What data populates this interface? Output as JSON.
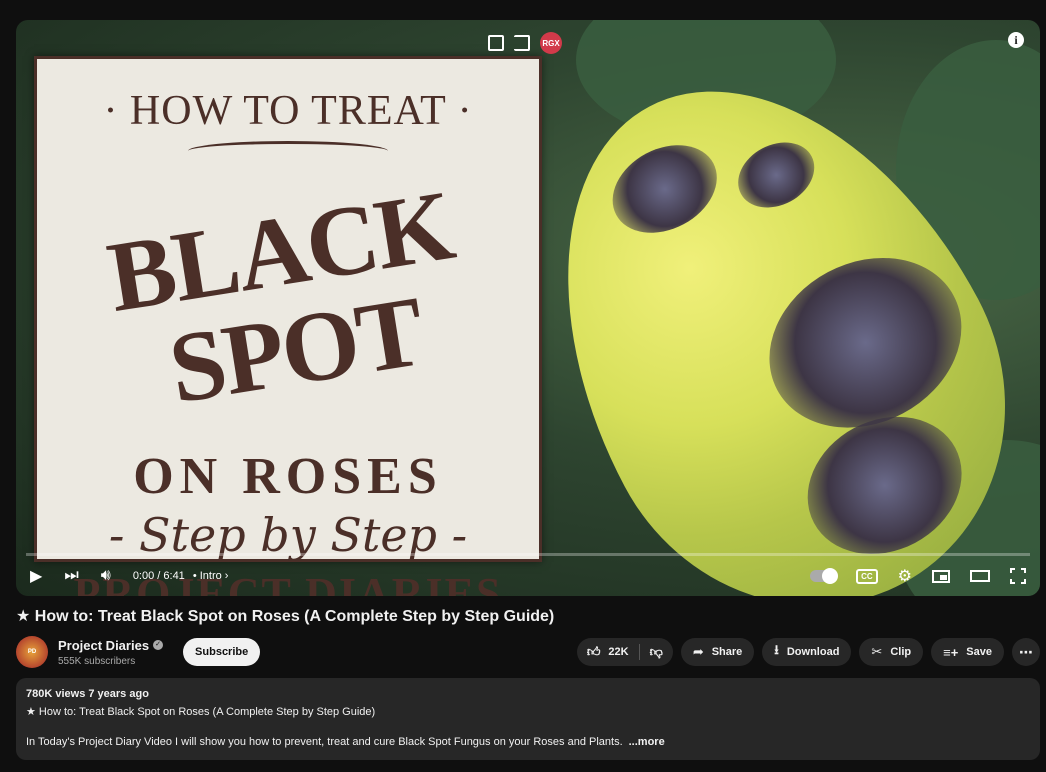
{
  "player": {
    "thumbnail": {
      "line1": "· HOW TO TREAT ·",
      "line2": "BLACK SPOT",
      "line3": "ON ROSES",
      "line4": "- Step by Step -",
      "line5": "PROJECT DIARIES"
    },
    "overlay_badge": "RGX",
    "time": "0:00 / 6:41",
    "chapter": "• Intro",
    "progress_fraction": 0.0
  },
  "video": {
    "title": "★ How to: Treat Black Spot on Roses (A Complete Step by Step Guide)"
  },
  "channel": {
    "name": "Project Diaries",
    "subscribers": "555K subscribers",
    "subscribe_label": "Subscribe"
  },
  "actions": {
    "likes": "22K",
    "share": "Share",
    "download": "Download",
    "clip": "Clip",
    "save": "Save"
  },
  "description": {
    "meta": "780K views  7 years ago",
    "title_line": "★ How to: Treat Black Spot on Roses (A Complete Step by Step Guide)",
    "body": "In Today's Project Diary Video I will show you how to prevent, treat and cure Black Spot Fungus on your Roses and Plants.",
    "more": "...more"
  }
}
